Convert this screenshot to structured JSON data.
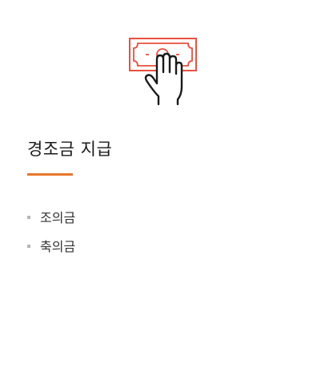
{
  "card": {
    "icon": "banknote-hand-icon",
    "title": "경조금 지급",
    "items": [
      {
        "label": "조의금"
      },
      {
        "label": "축의금"
      }
    ]
  },
  "colors": {
    "accent": "#e8772e",
    "icon_red": "#e8503f",
    "icon_dark": "#1a1a1a",
    "bullet": "#b5b5b5"
  }
}
